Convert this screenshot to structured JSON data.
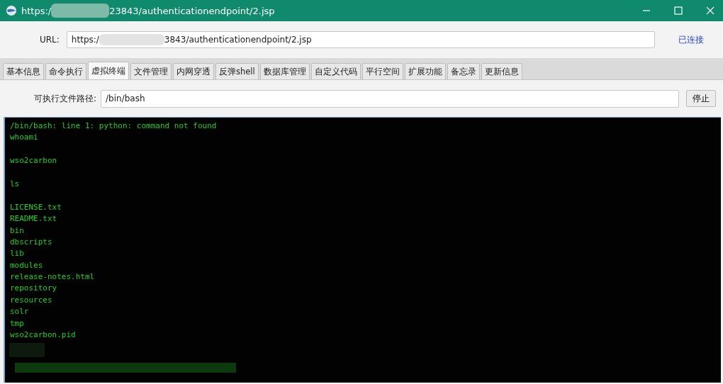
{
  "window": {
    "title_start": "https:/",
    "title_end": "23843/authenticationendpoint/2.jsp"
  },
  "url_bar": {
    "label": "URL:",
    "value_start": "https:/",
    "value_end": "3843/authenticationendpoint/2.jsp",
    "status": "已连接"
  },
  "tabs": [
    {
      "label": "基本信息",
      "selected": false
    },
    {
      "label": "命令执行",
      "selected": false
    },
    {
      "label": "虚拟终端",
      "selected": true
    },
    {
      "label": "文件管理",
      "selected": false
    },
    {
      "label": "内网穿透",
      "selected": false
    },
    {
      "label": "反弹shell",
      "selected": false
    },
    {
      "label": "数据库管理",
      "selected": false
    },
    {
      "label": "自定义代码",
      "selected": false
    },
    {
      "label": "平行空间",
      "selected": false
    },
    {
      "label": "扩展功能",
      "selected": false
    },
    {
      "label": "备忘录",
      "selected": false
    },
    {
      "label": "更新信息",
      "selected": false
    }
  ],
  "path_row": {
    "label": "可执行文件路径:",
    "value": "/bin/bash",
    "button": "停止"
  },
  "terminal": {
    "blocks": [
      [
        "/bin/bash: line 1: python: command not found",
        "whoami"
      ],
      [
        "wso2carbon"
      ],
      [
        "ls"
      ],
      [
        "LICENSE.txt",
        "README.txt",
        "bin",
        "dbscripts",
        "lib",
        "modules",
        "release-notes.html",
        "repository",
        "resources",
        "solr",
        "tmp",
        "wso2carbon.pid"
      ]
    ]
  }
}
